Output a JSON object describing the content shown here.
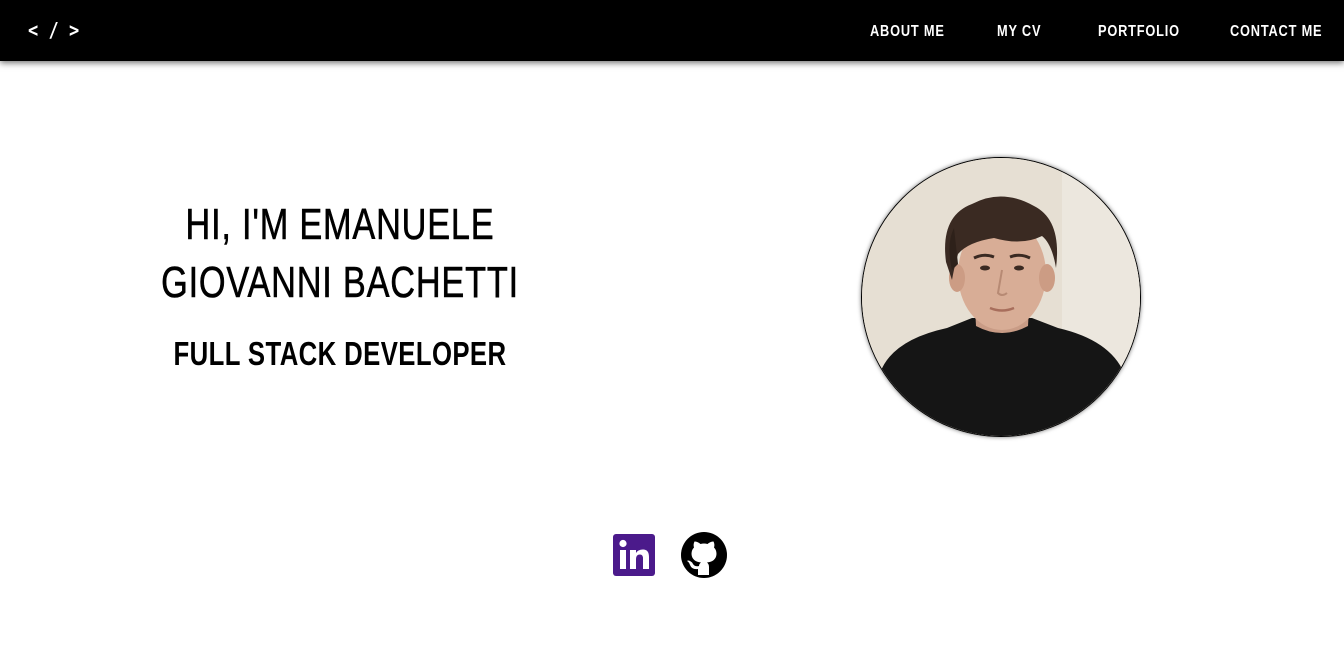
{
  "navbar": {
    "logo": "< / >",
    "links": [
      {
        "label": "ABOUT ME"
      },
      {
        "label": "MY CV"
      },
      {
        "label": "PORTFOLIO"
      },
      {
        "label": "CONTACT ME"
      }
    ]
  },
  "hero": {
    "title": "HI, I'M EMANUELE GIOVANNI BACHETTI",
    "subtitle": "FULL STACK DEVELOPER"
  },
  "social": {
    "linkedin_icon": "linkedin-icon",
    "github_icon": "github-icon"
  },
  "colors": {
    "navbar_bg": "#000000",
    "nav_text": "#ffffff",
    "linkedin": "#4b1a8b",
    "github": "#000000"
  }
}
